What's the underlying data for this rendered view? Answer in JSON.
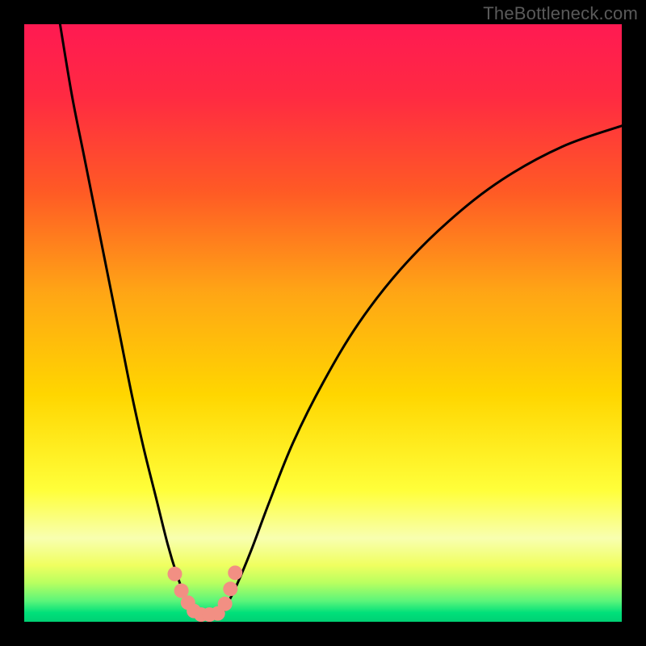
{
  "watermark": "TheBottleneck.com",
  "chart_data": {
    "type": "line",
    "title": "",
    "xlabel": "",
    "ylabel": "",
    "xlim": [
      0,
      100
    ],
    "ylim": [
      0,
      100
    ],
    "grid": false,
    "legend": false,
    "background_gradient_stops": [
      {
        "offset": 0.0,
        "color": "#ff1a52"
      },
      {
        "offset": 0.12,
        "color": "#ff2a42"
      },
      {
        "offset": 0.28,
        "color": "#ff5a25"
      },
      {
        "offset": 0.45,
        "color": "#ffa615"
      },
      {
        "offset": 0.62,
        "color": "#ffd600"
      },
      {
        "offset": 0.78,
        "color": "#ffff3a"
      },
      {
        "offset": 0.86,
        "color": "#f8ffb0"
      },
      {
        "offset": 0.905,
        "color": "#f0ff60"
      },
      {
        "offset": 0.935,
        "color": "#b8ff60"
      },
      {
        "offset": 0.965,
        "color": "#5cf57a"
      },
      {
        "offset": 0.985,
        "color": "#00e07a"
      },
      {
        "offset": 1.0,
        "color": "#00d074"
      }
    ],
    "series": [
      {
        "name": "left-branch",
        "x": [
          6,
          8,
          10,
          12,
          14,
          16,
          18,
          20,
          22,
          24,
          25.5,
          27,
          28,
          28.8
        ],
        "y": [
          100,
          88,
          78,
          68,
          58,
          48,
          38,
          29,
          21,
          13,
          8,
          4,
          2,
          1
        ]
      },
      {
        "name": "right-branch",
        "x": [
          33,
          34,
          35.5,
          38,
          41,
          45,
          50,
          56,
          63,
          71,
          80,
          90,
          100
        ],
        "y": [
          1,
          3,
          6,
          12,
          20,
          30,
          40,
          50,
          59,
          67,
          74,
          79.5,
          83
        ]
      },
      {
        "name": "valley-floor",
        "x": [
          28.8,
          30,
          31,
          32,
          33
        ],
        "y": [
          1,
          0.6,
          0.5,
          0.6,
          1
        ]
      }
    ],
    "markers": {
      "name": "salmon-dots",
      "color": "#f28f83",
      "radius_px": 9,
      "points": [
        {
          "x": 25.2,
          "y": 8.0
        },
        {
          "x": 26.3,
          "y": 5.2
        },
        {
          "x": 27.4,
          "y": 3.2
        },
        {
          "x": 28.4,
          "y": 1.8
        },
        {
          "x": 29.6,
          "y": 1.2
        },
        {
          "x": 31.0,
          "y": 1.2
        },
        {
          "x": 32.4,
          "y": 1.4
        },
        {
          "x": 33.6,
          "y": 3.0
        },
        {
          "x": 34.5,
          "y": 5.5
        },
        {
          "x": 35.3,
          "y": 8.2
        }
      ]
    }
  }
}
